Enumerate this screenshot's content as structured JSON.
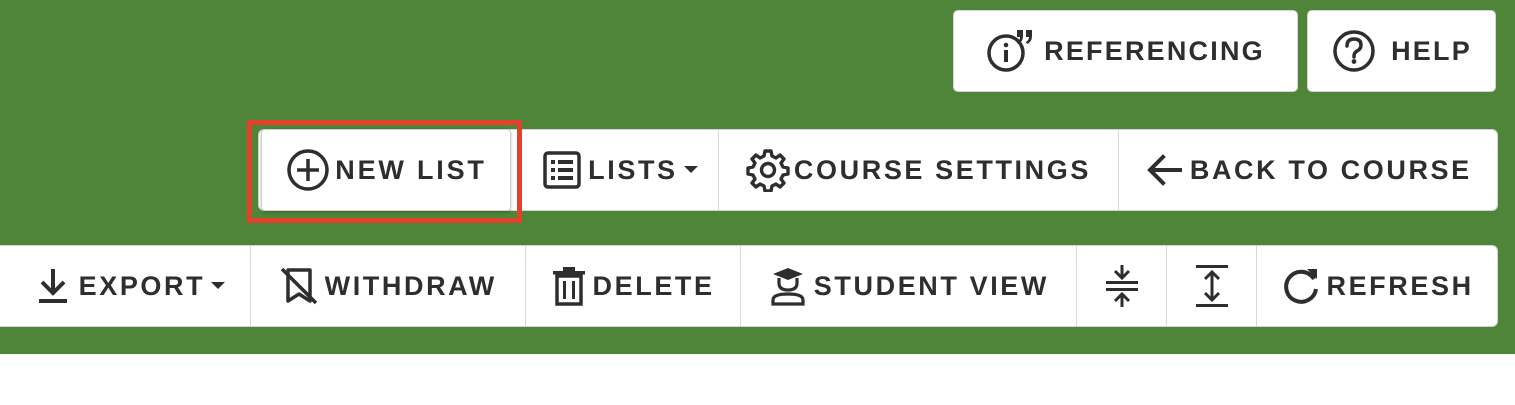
{
  "header": {
    "referencing_label": "REFERENCING",
    "help_label": "HELP"
  },
  "actions": {
    "new_list_label": "NEW LIST",
    "lists_label": "LISTS",
    "course_settings_label": "COURSE SETTINGS",
    "back_to_course_label": "BACK TO COURSE"
  },
  "toolbar": {
    "export_label": "EXPORT",
    "withdraw_label": "WITHDRAW",
    "delete_label": "DELETE",
    "student_view_label": "STUDENT VIEW",
    "refresh_label": "REFRESH"
  },
  "icons": {
    "referencing": "info-quote-icon",
    "help": "help-circle-icon",
    "new_list": "add-circle-icon",
    "lists": "list-icon",
    "course_settings": "gear-icon",
    "back_to_course": "arrow-left-icon",
    "export": "download-icon",
    "withdraw": "bookmark-off-icon",
    "delete": "trash-icon",
    "student_view": "student-icon",
    "collapse": "collapse-vertical-icon",
    "expand": "expand-vertical-icon",
    "refresh": "refresh-icon"
  },
  "colors": {
    "background_band": "#4e8538",
    "highlight": "#e2422b",
    "text": "#2e2e2e"
  }
}
